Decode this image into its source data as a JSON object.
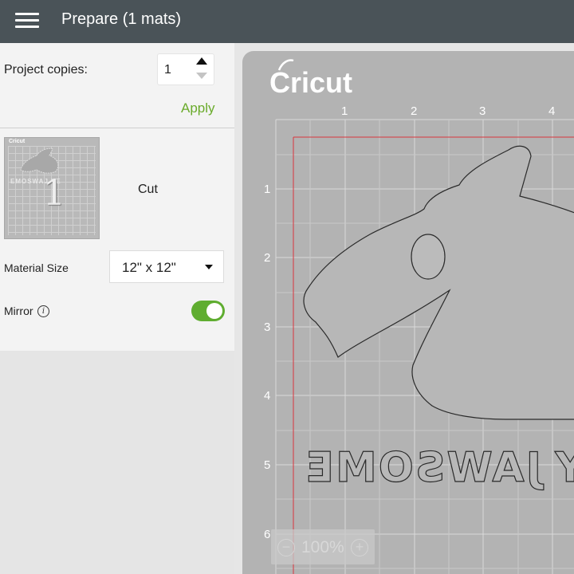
{
  "header": {
    "title": "Prepare (1 mats)",
    "menu_icon": "hamburger-menu-icon"
  },
  "left_panel": {
    "copies_label": "Project copies:",
    "copies_value": "1",
    "apply_label": "Apply",
    "mat": {
      "number": "1",
      "operation": "Cut",
      "brand": "Cricut",
      "text_preview": "EMOSWAJ YE"
    },
    "material_size_label": "Material Size",
    "material_size_value": "12\" x 12\"",
    "mirror_label": "Mirror",
    "mirror_on": true
  },
  "canvas": {
    "brand": "Cricut",
    "ruler_top": [
      "1",
      "2",
      "3",
      "4"
    ],
    "ruler_left": [
      "1",
      "2",
      "3",
      "4",
      "5",
      "6"
    ],
    "mirrored_text": "JAWSOME",
    "zoom": "100%"
  },
  "colors": {
    "header_bg": "#4a5358",
    "accent_green": "#6aab2b",
    "toggle_green": "#5fad30",
    "mat_gray": "#b3b3b3",
    "cut_line": "#d9343c"
  }
}
